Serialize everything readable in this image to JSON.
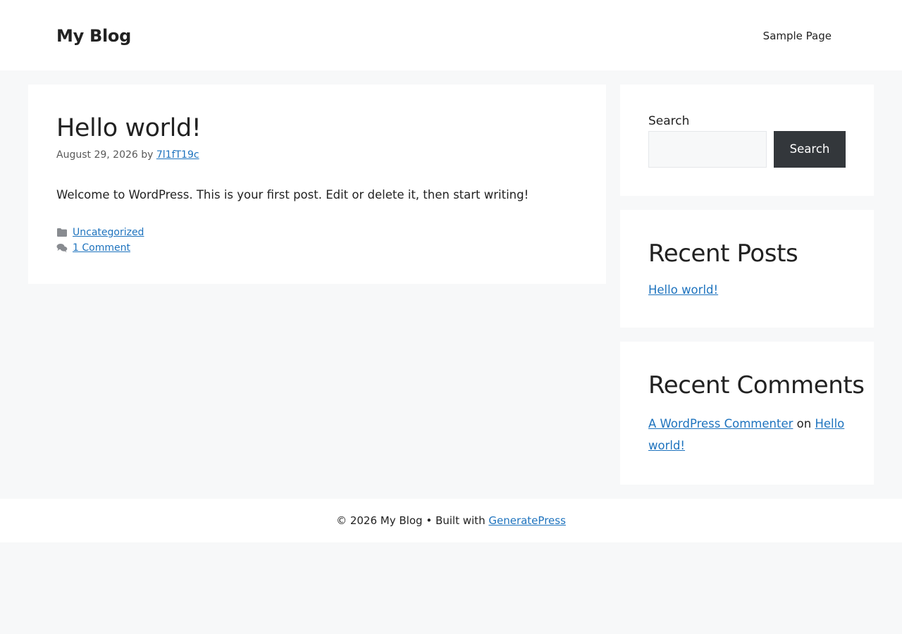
{
  "header": {
    "site_title": "My Blog",
    "nav": [
      {
        "label": "Sample Page"
      }
    ]
  },
  "post": {
    "title": "Hello world!",
    "date": "August 29, 2026",
    "by": "by",
    "author": "7l1fT19c",
    "content": "Welcome to WordPress. This is your first post. Edit or delete it, then start writing!",
    "category": "Uncategorized",
    "comments": "1 Comment"
  },
  "sidebar": {
    "search": {
      "label": "Search",
      "placeholder": "",
      "button_label": "Search"
    },
    "recent_posts": {
      "title": "Recent Posts",
      "items": [
        "Hello world!"
      ]
    },
    "recent_comments": {
      "title": "Recent Comments",
      "items": [
        {
          "author": "A WordPress Commenter",
          "on": "on",
          "post": "Hello world!"
        }
      ]
    }
  },
  "footer": {
    "copyright": "© 2026 My Blog",
    "separator": "•",
    "built_with": "Built with",
    "theme_link": "GeneratePress"
  },
  "colors": {
    "link": "#1e73be",
    "background": "#f7f8f9",
    "button": "#33373b",
    "text": "#222222"
  },
  "icons": {
    "category": "folder-icon",
    "comments": "comments-icon"
  }
}
